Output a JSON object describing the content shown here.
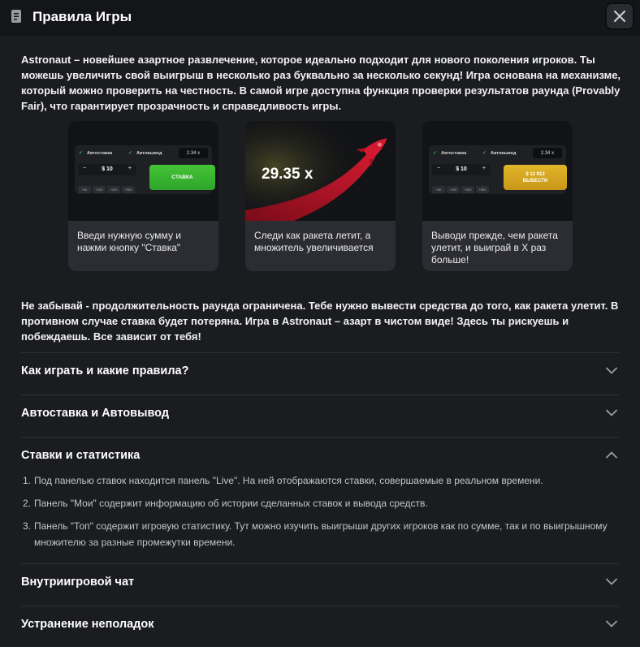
{
  "header": {
    "title": "Правила Игры",
    "doc_icon": "document-icon",
    "close_icon": "close-icon"
  },
  "intro": "Astronaut – новейшее азартное развлечение, которое идеально подходит для нового поколения игроков. Ты можешь увеличить свой выигрыш в несколько раз буквально за несколько секунд! Игра основана на механизме, который можно проверить на честность. В самой игре доступна функция проверки результатов раунда (Provably Fair), что гарантирует прозрачность и справедливость игры.",
  "cards": [
    {
      "caption": "Введи нужную сумму и нажми кнопку \"Ставка\"",
      "autobet_label": "Автоставка",
      "autocash_label": "Автовывод",
      "multiplier": "2.34 x",
      "amount": "$ 10",
      "minus": "−",
      "plus": "+",
      "quick": [
        "+50",
        "+100",
        "+200",
        "+500"
      ],
      "button": "СТАВКА"
    },
    {
      "caption": "Следи как ракета летит, а множитель увеличивается",
      "multiplier": "29.35 x"
    },
    {
      "caption": "Выводи прежде, чем ракета улетит, и выиграй в X раз больше!",
      "autobet_label": "Автоставка",
      "autocash_label": "Автовывод",
      "multiplier": "2.34 x",
      "amount": "$ 10",
      "minus": "−",
      "plus": "+",
      "quick": [
        "+50",
        "+100",
        "+200",
        "+500"
      ],
      "button_amount": "$ 12 912",
      "button": "ВЫВЕСТИ"
    }
  ],
  "note": "Не забывай - продолжительность раунда ограничена. Тебе нужно вывести средства до того, как ракета улетит. В противном случае ставка будет потеряна. Игра в Astronaut – азарт в чистом виде! Здесь ты рискуешь и побеждаешь. Все зависит от тебя!",
  "accordion": [
    {
      "title": "Как играть и какие правила?",
      "expanded": false
    },
    {
      "title": "Автоставка и Автовывод",
      "expanded": false
    },
    {
      "title": "Ставки и статистика",
      "expanded": true,
      "items": [
        {
          "num": "1.",
          "text": "Под панелью ставок находится панель \"Live\". На ней отображаются ставки, совершаемые в реальном времени."
        },
        {
          "num": "2.",
          "text": "Панель \"Мои\" содержит информацию об истории сделанных ставок и вывода средств."
        },
        {
          "num": "3.",
          "text": "Панель \"Топ\" содержит игровую статистику. Тут можно изучить выигрыши других игроков как по сумме, так и по выигрышному множителю за разные промежутки времени."
        }
      ]
    },
    {
      "title": "Внутриигровой чат",
      "expanded": false
    },
    {
      "title": "Устранение неполадок",
      "expanded": false
    }
  ],
  "colors": {
    "background": "#1b1c1f",
    "header": "#141518",
    "card": "#2c2d33",
    "stake_green": "#3cb832",
    "cashout_gold": "#d9a824",
    "rocket_red": "#c4142b"
  }
}
